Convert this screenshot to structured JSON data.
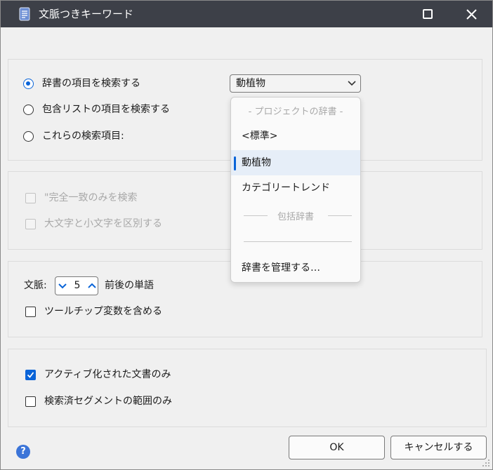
{
  "window": {
    "title": "文脈つきキーワード"
  },
  "search_scope": {
    "options": [
      {
        "label": "辞書の項目を検索する",
        "selected": true
      },
      {
        "label": "包含リストの項目を検索する",
        "selected": false
      },
      {
        "label": "これらの検索項目:",
        "selected": false
      }
    ],
    "dictionary_select": {
      "value": "動植物"
    },
    "dropdown": {
      "group_project": "- プロジェクトの辞書 -",
      "items": [
        {
          "label": "<標準>",
          "selected": false
        },
        {
          "label": "動植物",
          "selected": true
        },
        {
          "label": "カテゴリートレンド",
          "selected": false
        }
      ],
      "group_inclusive": "包括辞書",
      "manage": "辞書を管理する…"
    }
  },
  "match_options": {
    "exact_match": {
      "label": "\"完全一致のみを検索",
      "checked": false,
      "disabled": true
    },
    "case_sensitive": {
      "label": "大文字と小文字を区別する",
      "checked": false,
      "disabled": true
    }
  },
  "context": {
    "label": "文脈:",
    "words": 5,
    "suffix": "前後の単語",
    "include_tooltip_vars": {
      "label": "ツールチップ変数を含める",
      "checked": false
    }
  },
  "scope": {
    "active_docs_only": {
      "label": "アクティブ化された文書のみ",
      "checked": true
    },
    "searched_segments_only": {
      "label": "検索済セグメントの範囲のみ",
      "checked": false
    }
  },
  "buttons": {
    "ok": "OK",
    "cancel": "キャンセルする"
  },
  "help": "?",
  "colors": {
    "titlebar": "#3d4048",
    "accent": "#0a64d8",
    "disabled_text": "#a8a8a8"
  }
}
